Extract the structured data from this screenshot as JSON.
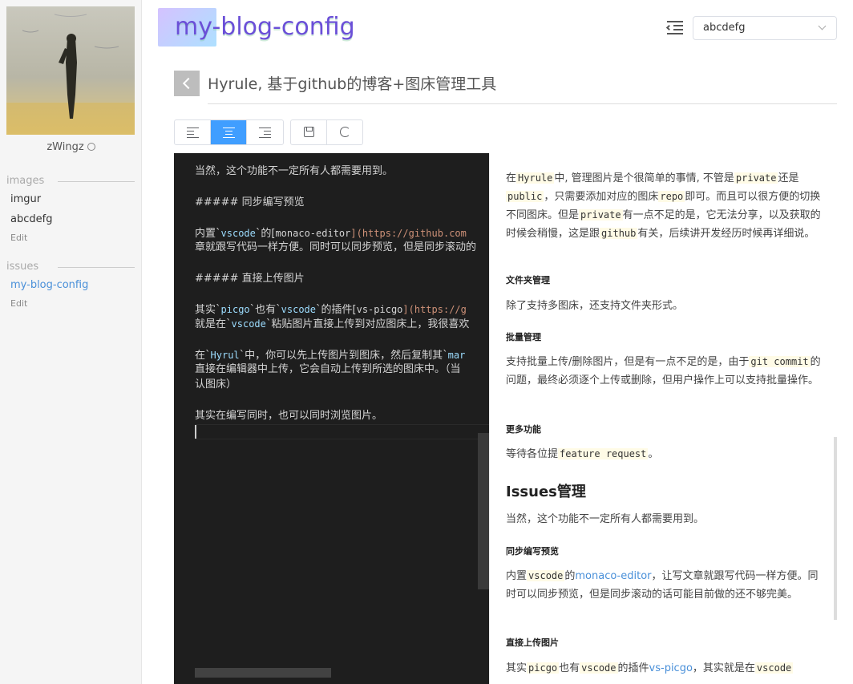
{
  "sidebar": {
    "username": "zWingz",
    "images_title": "images",
    "images_items": [
      "imgur",
      "abcdefg"
    ],
    "images_edit": "Edit",
    "issues_title": "issues",
    "issues_items": [
      "my-blog-config"
    ],
    "issues_edit": "Edit"
  },
  "header": {
    "app_title": "my-blog-config",
    "repo_selected": "abcdefg"
  },
  "article": {
    "title": "Hyrule, 基于github的博客+图床管理工具"
  },
  "editor": {
    "line1": "当然，这个功能不一定所有人都需要用到。",
    "line2": "##### 同步编写预览",
    "line3a": "内置`",
    "line3b": "vscode",
    "line3c": "`的[",
    "line3d": "monaco-editor",
    "line3e": "](https://github.com",
    "line4": "章就跟写代码一样方便。同时可以同步预览，但是同步滚动的",
    "line5": "##### 直接上传图片",
    "line6a": "其实`",
    "line6b": "picgo",
    "line6c": "`也有`",
    "line6d": "vscode",
    "line6e": "`的插件[",
    "line6f": "vs-picgo",
    "line6g": "](https://g",
    "line7a": "就是在`",
    "line7b": "vscode",
    "line7c": "`粘贴图片直接上传到对应图床上，我很喜欢",
    "line8a": "在`",
    "line8b": "Hyrul",
    "line8c": "`中，你可以先上传图片到图床，然后复制其`",
    "line8d": "mar",
    "line9": "直接在编辑器中上传，它会自动上传到所选的图床中。（当",
    "line10": "认图床）",
    "line11": "其实在编写同时，也可以同时浏览图片。"
  },
  "preview": {
    "p1a": "在",
    "p1b": "Hyrule",
    "p1c": "中, 管理图片是个很简单的事情, 不管是",
    "p1d": "private",
    "p1e": "还是",
    "p1f": "public",
    "p1g": "，只需要添加对应的图床",
    "p1h": "repo",
    "p1i": "即可。而且可以很方便的切换不同图床。但是",
    "p1j": "private",
    "p1k": "有一点不足的是，它无法分享，以及获取的时候会稍慢，这是跟",
    "p1l": "github",
    "p1m": "有关，后续讲开发经历时候再详细说。",
    "h_folder": "文件夹管理",
    "p2": "除了支持多图床，还支持文件夹形式。",
    "h_batch": "批量管理",
    "p3a": "支持批量上传/删除图片，但是有一点不足的是，由于",
    "p3b": "git commit",
    "p3c": "的问题，最终必须逐个上传或删除，但用户操作上可以支持批量操作。",
    "h_more": "更多功能",
    "p4a": "等待各位提",
    "p4b": "feature request",
    "p4c": "。",
    "h_issues": "Issues管理",
    "p5": "当然，这个功能不一定所有人都需要用到。",
    "h_sync": "同步编写预览",
    "p6a": "内置",
    "p6b": "vscode",
    "p6c": "的",
    "p6d": "monaco-editor",
    "p6e": "，让写文章就跟写代码一样方便。同时可以同步预览，但是同步滚动的话可能目前做的还不够完美。",
    "h_upload": "直接上传图片",
    "p7a": "其实",
    "p7b": "picgo",
    "p7c": "也有",
    "p7d": "vscode",
    "p7e": "的插件",
    "p7f": "vs-picgo",
    "p7g": "，其实就是在",
    "p7h": "vscode"
  }
}
